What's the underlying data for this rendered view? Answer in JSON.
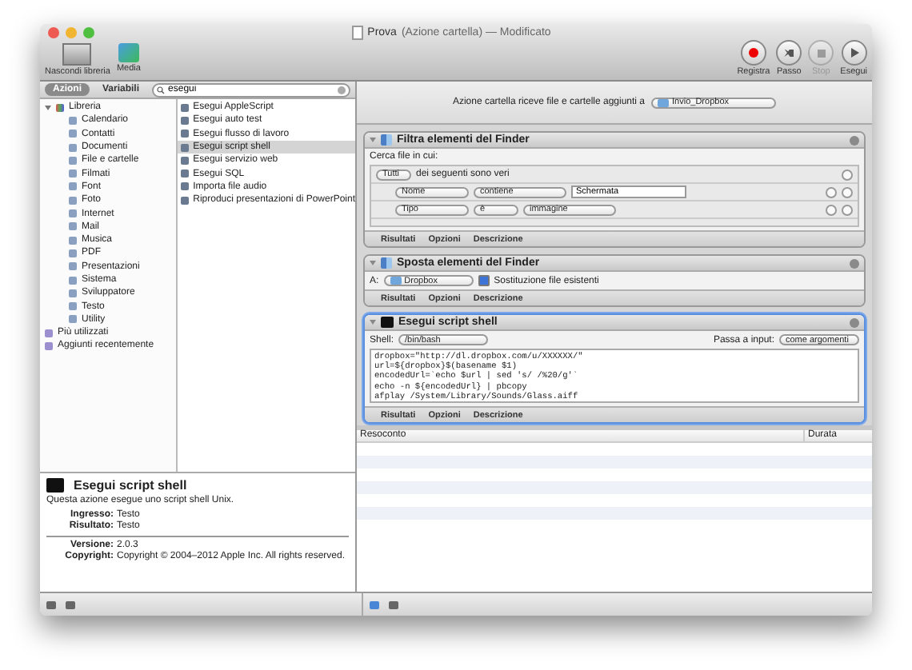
{
  "window": {
    "title_name": "Prova",
    "title_detail": "(Azione cartella) — Modificato"
  },
  "toolbar_left": [
    {
      "label": "Nascondi libreria",
      "kind": "library"
    },
    {
      "label": "Media",
      "kind": "media"
    }
  ],
  "toolbar_right": [
    {
      "label": "Registra",
      "kind": "record",
      "disabled": false
    },
    {
      "label": "Passo",
      "kind": "step",
      "disabled": false
    },
    {
      "label": "Stop",
      "kind": "stop",
      "disabled": true
    },
    {
      "label": "Esegui",
      "kind": "run",
      "disabled": false
    }
  ],
  "library_tabs": [
    {
      "label": "Azioni",
      "selected": true
    },
    {
      "label": "Variabili",
      "selected": false
    }
  ],
  "search": {
    "value": "esegui"
  },
  "library": [
    {
      "label": "Libreria",
      "kind": "library",
      "expanded": true,
      "children": [
        {
          "label": "Calendario"
        },
        {
          "label": "Contatti"
        },
        {
          "label": "Documenti"
        },
        {
          "label": "File e cartelle"
        },
        {
          "label": "Filmati"
        },
        {
          "label": "Font"
        },
        {
          "label": "Foto"
        },
        {
          "label": "Internet"
        },
        {
          "label": "Mail"
        },
        {
          "label": "Musica"
        },
        {
          "label": "PDF"
        },
        {
          "label": "Presentazioni"
        },
        {
          "label": "Sistema"
        },
        {
          "label": "Sviluppatore"
        },
        {
          "label": "Testo"
        },
        {
          "label": "Utility"
        }
      ]
    },
    {
      "label": "Più utilizzati",
      "kind": "smart"
    },
    {
      "label": "Aggiunti recentemente",
      "kind": "smart"
    }
  ],
  "action_list": [
    {
      "label": "Esegui AppleScript",
      "selected": false
    },
    {
      "label": "Esegui auto test",
      "selected": false
    },
    {
      "label": "Esegui flusso di lavoro",
      "selected": false
    },
    {
      "label": "Esegui script shell",
      "selected": true
    },
    {
      "label": "Esegui servizio web",
      "selected": false
    },
    {
      "label": "Esegui SQL",
      "selected": false
    },
    {
      "label": "Importa file audio",
      "selected": false
    },
    {
      "label": "Riproduci presentazioni di PowerPoint",
      "selected": false
    }
  ],
  "description": {
    "title": "Esegui script shell",
    "text": "Questa azione esegue uno script shell Unix.",
    "io": [
      {
        "label": "Ingresso:",
        "value": "Testo"
      },
      {
        "label": "Risultato:",
        "value": "Testo"
      }
    ],
    "meta": [
      {
        "label": "Versione:",
        "value": "2.0.3"
      },
      {
        "label": "Copyright:",
        "value": "Copyright © 2004–2012 Apple Inc.  All rights reserved."
      }
    ]
  },
  "workflow_header": {
    "label": "Azione cartella riceve file e cartelle aggiunti a",
    "folder": "Invio_Dropbox"
  },
  "actions": [
    {
      "kind": "filter",
      "title": "Filtra elementi del Finder",
      "expanded": true,
      "selected": false,
      "search_label": "Cerca file in cui:",
      "match": "Tutti",
      "match_text": "dei seguenti sono veri",
      "rules": [
        {
          "field": "Nome",
          "op": "contiene",
          "value": "Schermata",
          "kind": "text"
        },
        {
          "field": "Tipo",
          "op": "è",
          "value": "immagine",
          "kind": "popup"
        }
      ],
      "footer": [
        "Risultati",
        "Opzioni",
        "Descrizione"
      ]
    },
    {
      "kind": "move",
      "title": "Sposta elementi del Finder",
      "expanded": true,
      "selected": false,
      "to_label": "A:",
      "folder": "Dropbox",
      "replace_label": "Sostituzione file esistenti",
      "replace_checked": true,
      "footer": [
        "Risultati",
        "Opzioni",
        "Descrizione"
      ]
    },
    {
      "kind": "shell",
      "title": "Esegui script shell",
      "expanded": true,
      "selected": true,
      "shell_label": "Shell:",
      "shell": "/bin/bash",
      "input_label": "Passa a input:",
      "input": "come argomenti",
      "code": [
        "dropbox=\"http://dl.dropbox.com/u/XXXXXX/\"",
        "url=${dropbox}$(basename $1)",
        "encodedUrl=`echo $url | sed 's/ /%20/g'`",
        "echo -n ${encodedUrl} | pbcopy",
        "afplay /System/Library/Sounds/Glass.aiff"
      ],
      "footer": [
        "Risultati",
        "Opzioni",
        "Descrizione"
      ]
    }
  ],
  "log": {
    "columns": [
      "Resoconto",
      "Durata"
    ]
  }
}
